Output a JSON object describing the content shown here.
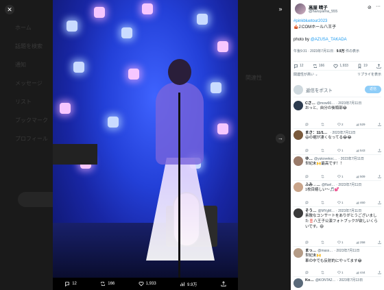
{
  "background": {
    "ghost_texts": [
      "ホーム",
      "話題を検索",
      "通知",
      "メッセージ",
      "リスト",
      "ブックマーク",
      "プロフィール"
    ],
    "right_hint": "関連性"
  },
  "viewer": {
    "close_icon": "close-icon",
    "collapse_icon": "collapse-icon",
    "next_icon": "chevron-right-icon",
    "bar": {
      "replies": "12",
      "reposts": "166",
      "likes": "1,933",
      "views": "9.9万"
    }
  },
  "tweet": {
    "author_name": "高屋 晴子",
    "author_handle": "@haruyama_555",
    "hashtag": "#pinkbluetour2023",
    "line2": "🎪J:COMホール八王子",
    "photo_prefix": "photo by ",
    "photo_credit": "@AZUSA_TAKADA",
    "time": "午後9:31 · 2023年7月11日 · ",
    "views_count": "9.9万",
    "views_suffix": " 件の表示",
    "stats": {
      "replies": "12",
      "reposts": "166",
      "likes": "1,933",
      "bookmarks": "19"
    },
    "sort_label": "関連性が高い ⌄",
    "sort_right": "リプライを表示"
  },
  "reply_box": {
    "placeholder": "返信をポスト",
    "button": "返信"
  },
  "replies": [
    {
      "name": "Cさ…",
      "handle": "@mow66…",
      "date": "· 2023年7月11日",
      "text": "おっと、自分の後頭部😂",
      "r": "",
      "rt": "",
      "l": "2",
      "v": "529"
    },
    {
      "name": "まさ：11/1…",
      "handle": "",
      "date": "· 2023年7月11日",
      "text": "😃の裾が凄くなってる😂😂",
      "r": "",
      "rt": "",
      "l": "1",
      "v": "543"
    },
    {
      "name": "ゆ…",
      "handle": "@yukovekoc…",
      "date": "· 2023年7月11日",
      "text": "世紀末🙌最高です！！",
      "r": "",
      "rt": "",
      "l": "1",
      "v": "509"
    },
    {
      "name": "ふみ→…",
      "handle": "@fluel…",
      "date": "· 2023年7月11日",
      "text": "1枚目嬉しい〜🎵💕",
      "r": "",
      "rt": "",
      "l": "1",
      "v": "460"
    },
    {
      "name": "そう…",
      "handle": "@MYgM…",
      "date": "· 2023年7月11日",
      "text": "素敵なコンサートをありがとうございました‼️八王子公演フォトブックが欲しいくらいです。😄",
      "r": "",
      "rt": "",
      "l": "1",
      "v": "258"
    },
    {
      "name": "まっ…",
      "handle": "@mass…",
      "date": "· 2023年7月11日",
      "text": "世紀末🙌\n車の中でも反射的にやってます😂",
      "r": "",
      "rt": "",
      "l": "1",
      "v": "444"
    },
    {
      "name": "Ko…",
      "handle": "@KONTA2…",
      "date": "· 2023年7月13日",
      "text": "",
      "r": "",
      "rt": "",
      "l": "",
      "v": ""
    }
  ],
  "colors": {
    "accent": "#1d9bf0",
    "reply_button": "#8ecdf8",
    "stage_blue": "#2340d8"
  }
}
